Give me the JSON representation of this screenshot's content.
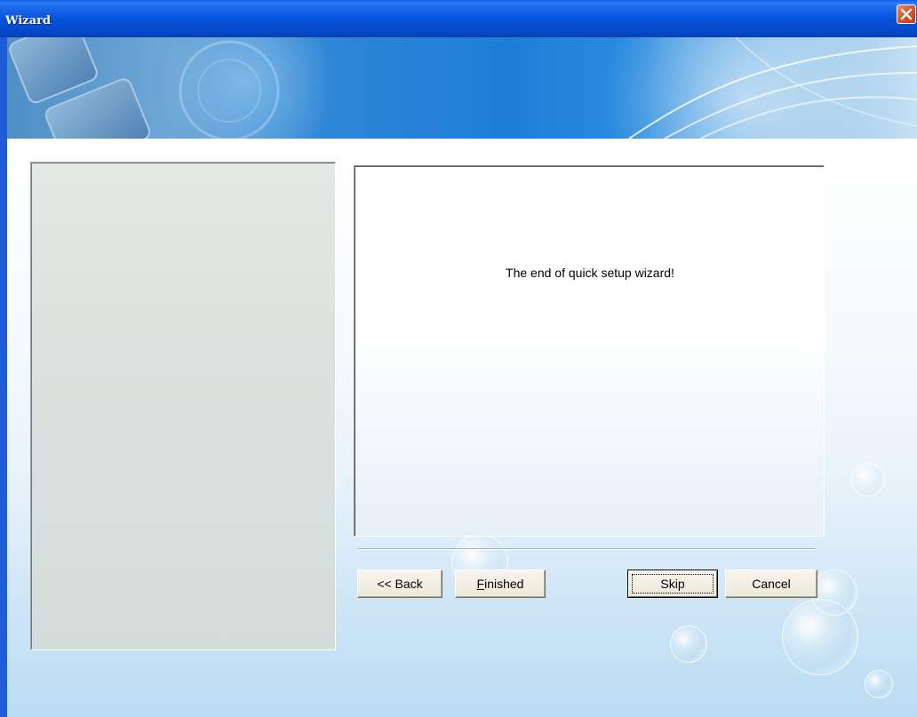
{
  "window": {
    "title": "Wizard",
    "close_icon": "close-icon"
  },
  "main": {
    "message": "The end of quick setup wizard!"
  },
  "buttons": {
    "back": "<< Back",
    "finished_accel": "F",
    "finished_rest": "inished",
    "skip": "Skip",
    "cancel": "Cancel"
  },
  "colors": {
    "titlebar": "#0551d8",
    "close_button": "#e2552b",
    "button_face": "#ece9d8"
  }
}
